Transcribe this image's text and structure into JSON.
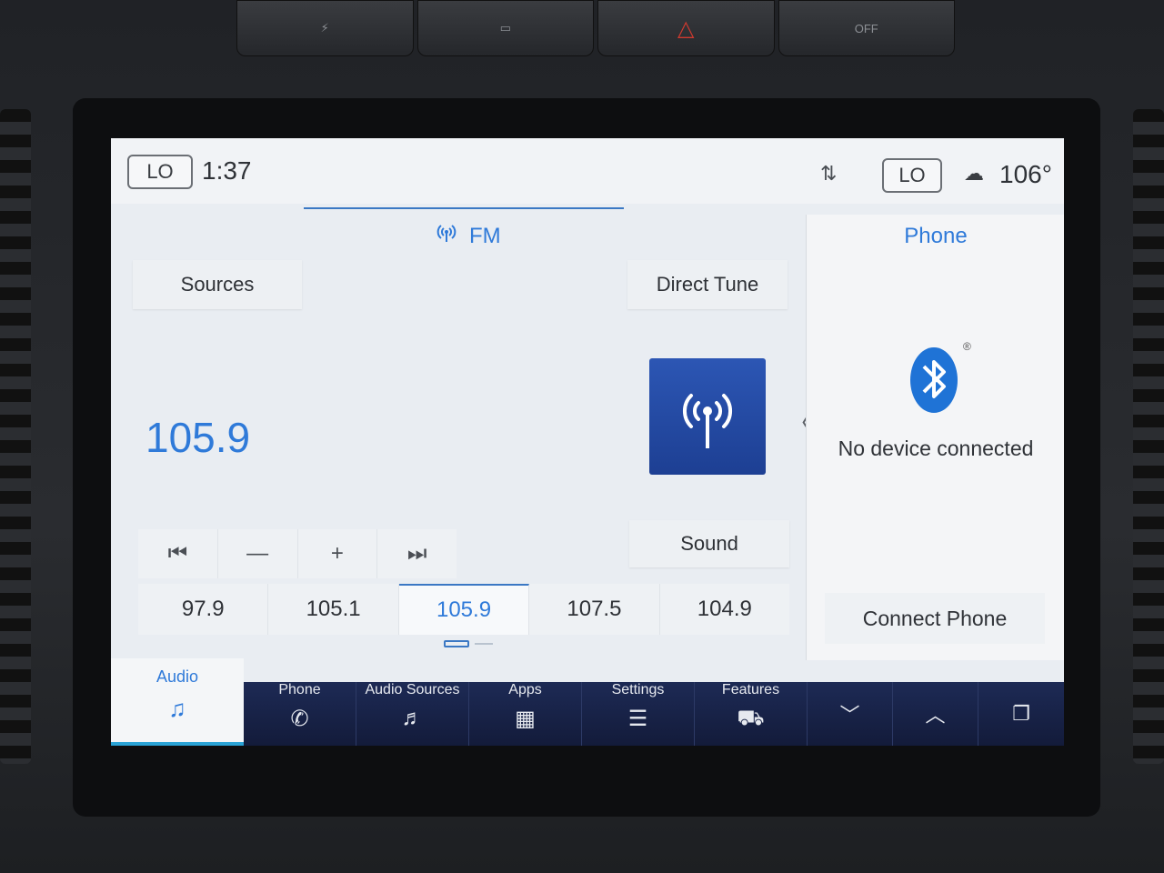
{
  "status_bar": {
    "climate_left": "LO",
    "time": "1:37",
    "sync_icon": "sort-arrows-icon",
    "climate_right": "LO",
    "weather_icon": "cloud-thermometer-icon",
    "outside_temp": "106°"
  },
  "audio": {
    "band_label": "FM",
    "sources_label": "Sources",
    "direct_tune_label": "Direct Tune",
    "current_frequency": "105.9",
    "sound_label": "Sound",
    "controls": {
      "seek_back": "⏮",
      "tune_down": "—",
      "tune_up": "+",
      "seek_forward": "⏭"
    },
    "presets": [
      "97.9",
      "105.1",
      "105.9",
      "107.5",
      "104.9"
    ],
    "active_preset_index": 2,
    "collapse_chevron": "〈"
  },
  "phone_panel": {
    "title": "Phone",
    "status": "No device connected",
    "connect_label": "Connect Phone",
    "registered_mark": "®"
  },
  "nav": {
    "audio_label": "Audio",
    "audio_icon": "♫",
    "items": [
      {
        "label": "Phone",
        "icon": "✆"
      },
      {
        "label": "Audio Sources",
        "icon": "♬"
      },
      {
        "label": "Apps",
        "icon": "▦"
      },
      {
        "label": "Settings",
        "icon": "☰"
      },
      {
        "label": "Features",
        "icon": "⛟"
      }
    ],
    "system_icons": [
      "﹀",
      "︿",
      "❐"
    ]
  },
  "hardware_buttons": [
    "⚡",
    "▭",
    "△",
    "OFF"
  ]
}
